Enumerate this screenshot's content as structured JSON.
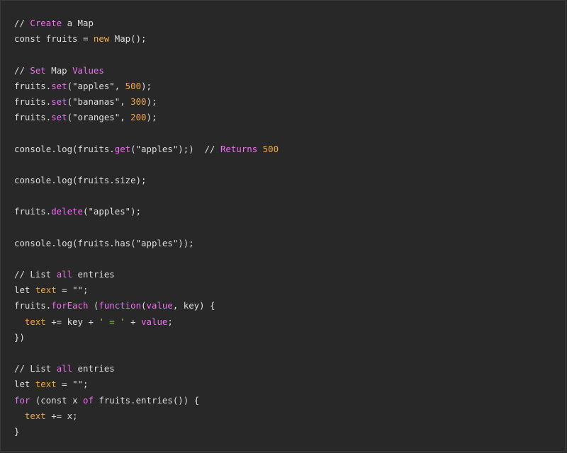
{
  "editor": {
    "language": "javascript",
    "colors": {
      "background": "#282828",
      "plain": "#dedede",
      "keyword": "#f06ef0",
      "number": "#f0a848",
      "string": "#9cdc6c",
      "identifier": "#f0a848"
    },
    "lines": [
      [
        {
          "t": "// ",
          "c": "plain"
        },
        {
          "t": "Create",
          "c": "keyword"
        },
        {
          "t": " a Map",
          "c": "plain"
        }
      ],
      [
        {
          "t": "const fruits = ",
          "c": "plain"
        },
        {
          "t": "new",
          "c": "ident"
        },
        {
          "t": " Map();",
          "c": "plain"
        }
      ],
      [],
      [
        {
          "t": "// ",
          "c": "plain"
        },
        {
          "t": "Set",
          "c": "keyword"
        },
        {
          "t": " Map ",
          "c": "plain"
        },
        {
          "t": "Values",
          "c": "keyword"
        }
      ],
      [
        {
          "t": "fruits.",
          "c": "plain"
        },
        {
          "t": "set",
          "c": "keyword"
        },
        {
          "t": "(\"apples\", ",
          "c": "plain"
        },
        {
          "t": "500",
          "c": "number"
        },
        {
          "t": ");",
          "c": "plain"
        }
      ],
      [
        {
          "t": "fruits.",
          "c": "plain"
        },
        {
          "t": "set",
          "c": "keyword"
        },
        {
          "t": "(\"bananas\", ",
          "c": "plain"
        },
        {
          "t": "300",
          "c": "number"
        },
        {
          "t": ");",
          "c": "plain"
        }
      ],
      [
        {
          "t": "fruits.",
          "c": "plain"
        },
        {
          "t": "set",
          "c": "keyword"
        },
        {
          "t": "(\"oranges\", ",
          "c": "plain"
        },
        {
          "t": "200",
          "c": "number"
        },
        {
          "t": ");",
          "c": "plain"
        }
      ],
      [],
      [
        {
          "t": "console.log(fruits.",
          "c": "plain"
        },
        {
          "t": "get",
          "c": "keyword"
        },
        {
          "t": "(\"apples\");)  // ",
          "c": "plain"
        },
        {
          "t": "Returns",
          "c": "keyword"
        },
        {
          "t": " ",
          "c": "plain"
        },
        {
          "t": "500",
          "c": "number"
        }
      ],
      [],
      [
        {
          "t": "console.log(fruits.size);",
          "c": "plain"
        }
      ],
      [],
      [
        {
          "t": "fruits.",
          "c": "plain"
        },
        {
          "t": "delete",
          "c": "keyword"
        },
        {
          "t": "(\"apples\");",
          "c": "plain"
        }
      ],
      [],
      [
        {
          "t": "console.log(fruits.has(\"apples\"));",
          "c": "plain"
        }
      ],
      [],
      [
        {
          "t": "// List ",
          "c": "plain"
        },
        {
          "t": "all",
          "c": "keyword"
        },
        {
          "t": " entries",
          "c": "plain"
        }
      ],
      [
        {
          "t": "let ",
          "c": "plain"
        },
        {
          "t": "text",
          "c": "ident"
        },
        {
          "t": " = \"\";",
          "c": "plain"
        }
      ],
      [
        {
          "t": "fruits.",
          "c": "plain"
        },
        {
          "t": "forEach",
          "c": "keyword"
        },
        {
          "t": " (",
          "c": "plain"
        },
        {
          "t": "function",
          "c": "keyword"
        },
        {
          "t": "(",
          "c": "plain"
        },
        {
          "t": "value",
          "c": "keyword"
        },
        {
          "t": ", key) {",
          "c": "plain"
        }
      ],
      [
        {
          "t": "  ",
          "c": "plain"
        },
        {
          "t": "text",
          "c": "ident"
        },
        {
          "t": " += key + ",
          "c": "plain"
        },
        {
          "t": "' = '",
          "c": "string"
        },
        {
          "t": " + ",
          "c": "plain"
        },
        {
          "t": "value",
          "c": "keyword"
        },
        {
          "t": ";",
          "c": "plain"
        }
      ],
      [
        {
          "t": "})",
          "c": "plain"
        }
      ],
      [],
      [
        {
          "t": "// List ",
          "c": "plain"
        },
        {
          "t": "all",
          "c": "keyword"
        },
        {
          "t": " entries",
          "c": "plain"
        }
      ],
      [
        {
          "t": "let ",
          "c": "plain"
        },
        {
          "t": "text",
          "c": "ident"
        },
        {
          "t": " = \"\";",
          "c": "plain"
        }
      ],
      [
        {
          "t": "for",
          "c": "keyword"
        },
        {
          "t": " (const x ",
          "c": "plain"
        },
        {
          "t": "of",
          "c": "keyword"
        },
        {
          "t": " fruits.entries()) {",
          "c": "plain"
        }
      ],
      [
        {
          "t": "  ",
          "c": "plain"
        },
        {
          "t": "text",
          "c": "ident"
        },
        {
          "t": " += x;",
          "c": "plain"
        }
      ],
      [
        {
          "t": "}",
          "c": "plain"
        }
      ]
    ]
  }
}
